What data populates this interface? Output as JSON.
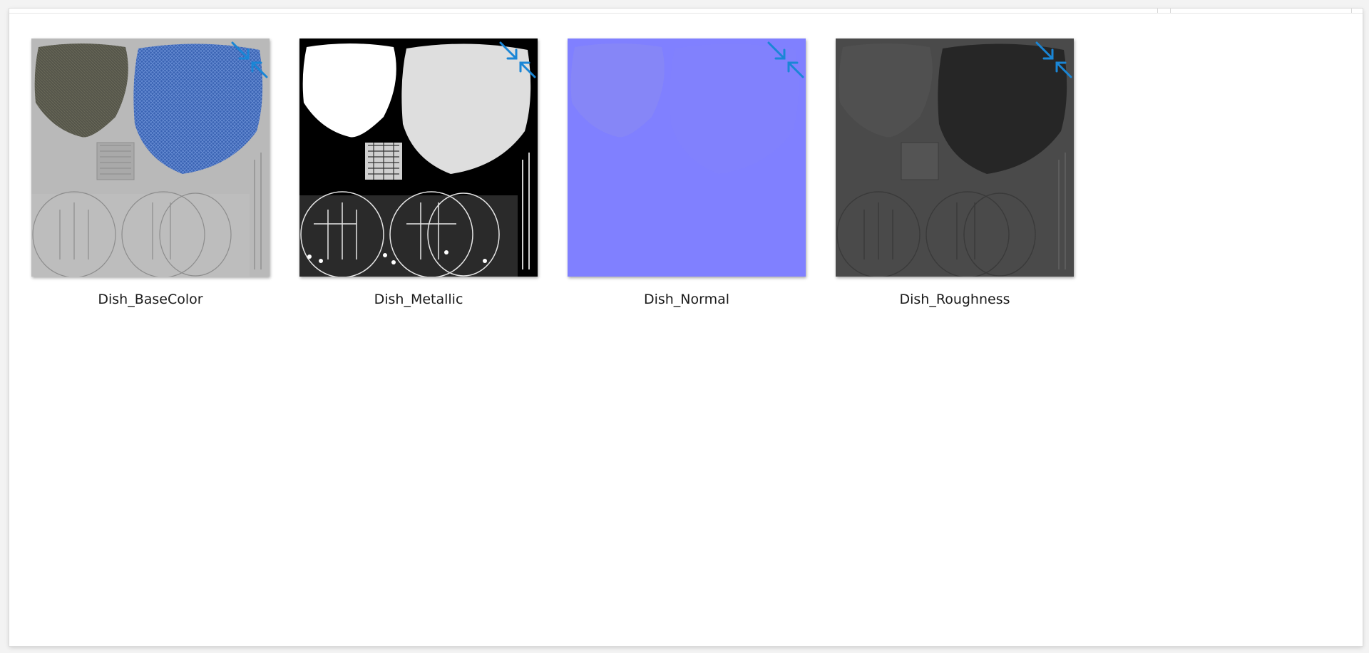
{
  "window": {
    "view": "large-icons"
  },
  "files": [
    {
      "name": "Dish_BaseColor",
      "thumbnail": "basecolor-texture",
      "background": "#b9b9b9",
      "badge_icon": "compress-arrows-icon"
    },
    {
      "name": "Dish_Metallic",
      "thumbnail": "metallic-texture",
      "background": "#000000",
      "badge_icon": "compress-arrows-icon"
    },
    {
      "name": "Dish_Normal",
      "thumbnail": "normal-texture",
      "background": "#8080ff",
      "badge_icon": "compress-arrows-icon"
    },
    {
      "name": "Dish_Roughness",
      "thumbnail": "roughness-texture",
      "background": "#4a4a4a",
      "badge_icon": "compress-arrows-icon"
    }
  ],
  "colors": {
    "badge_blue": "#1a86d6",
    "basecolor_blue": "#3a63b3",
    "basecolor_olive": "#5a5a48"
  }
}
